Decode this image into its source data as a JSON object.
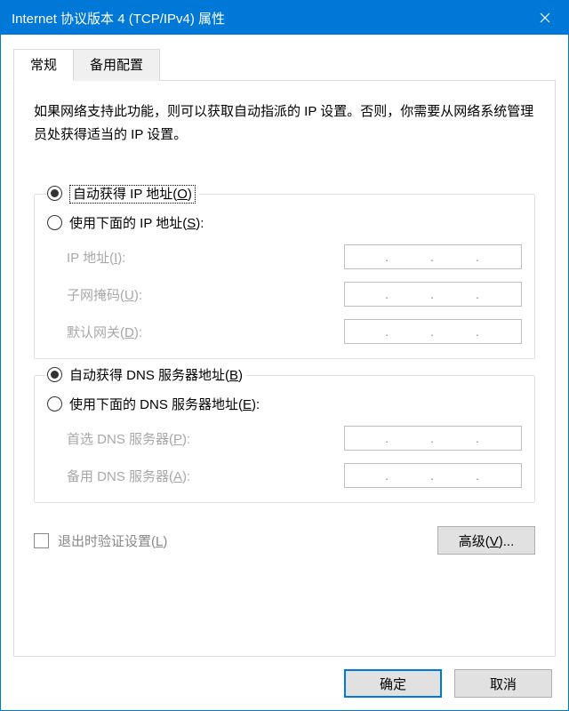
{
  "titlebar": {
    "title": "Internet 协议版本 4 (TCP/IPv4) 属性"
  },
  "tabs": {
    "general": "常规",
    "alternate": "备用配置"
  },
  "intro": "如果网络支持此功能，则可以获取自动指派的 IP 设置。否则，你需要从网络系统管理员处获得适当的 IP 设置。",
  "ip": {
    "auto_label": "自动获得 IP 地址(",
    "auto_accel": "O",
    "auto_suffix": ")",
    "manual_label": "使用下面的 IP 地址(",
    "manual_accel": "S",
    "manual_suffix": "):",
    "field_ip": "IP 地址(",
    "field_ip_accel": "I",
    "field_mask": "子网掩码(",
    "field_mask_accel": "U",
    "field_gw": "默认网关(",
    "field_gw_accel": "D",
    "field_suffix": "):"
  },
  "dns": {
    "auto_label": "自动获得 DNS 服务器地址(",
    "auto_accel": "B",
    "auto_suffix": ")",
    "manual_label": "使用下面的 DNS 服务器地址(",
    "manual_accel": "E",
    "manual_suffix": "):",
    "field_pref": "首选 DNS 服务器(",
    "field_pref_accel": "P",
    "field_alt": "备用 DNS 服务器(",
    "field_alt_accel": "A",
    "field_suffix": "):"
  },
  "validate": {
    "label": "退出时验证设置(",
    "accel": "L",
    "suffix": ")"
  },
  "buttons": {
    "advanced": "高级(",
    "advanced_accel": "V",
    "advanced_suffix": ")...",
    "ok": "确定",
    "cancel": "取消"
  }
}
